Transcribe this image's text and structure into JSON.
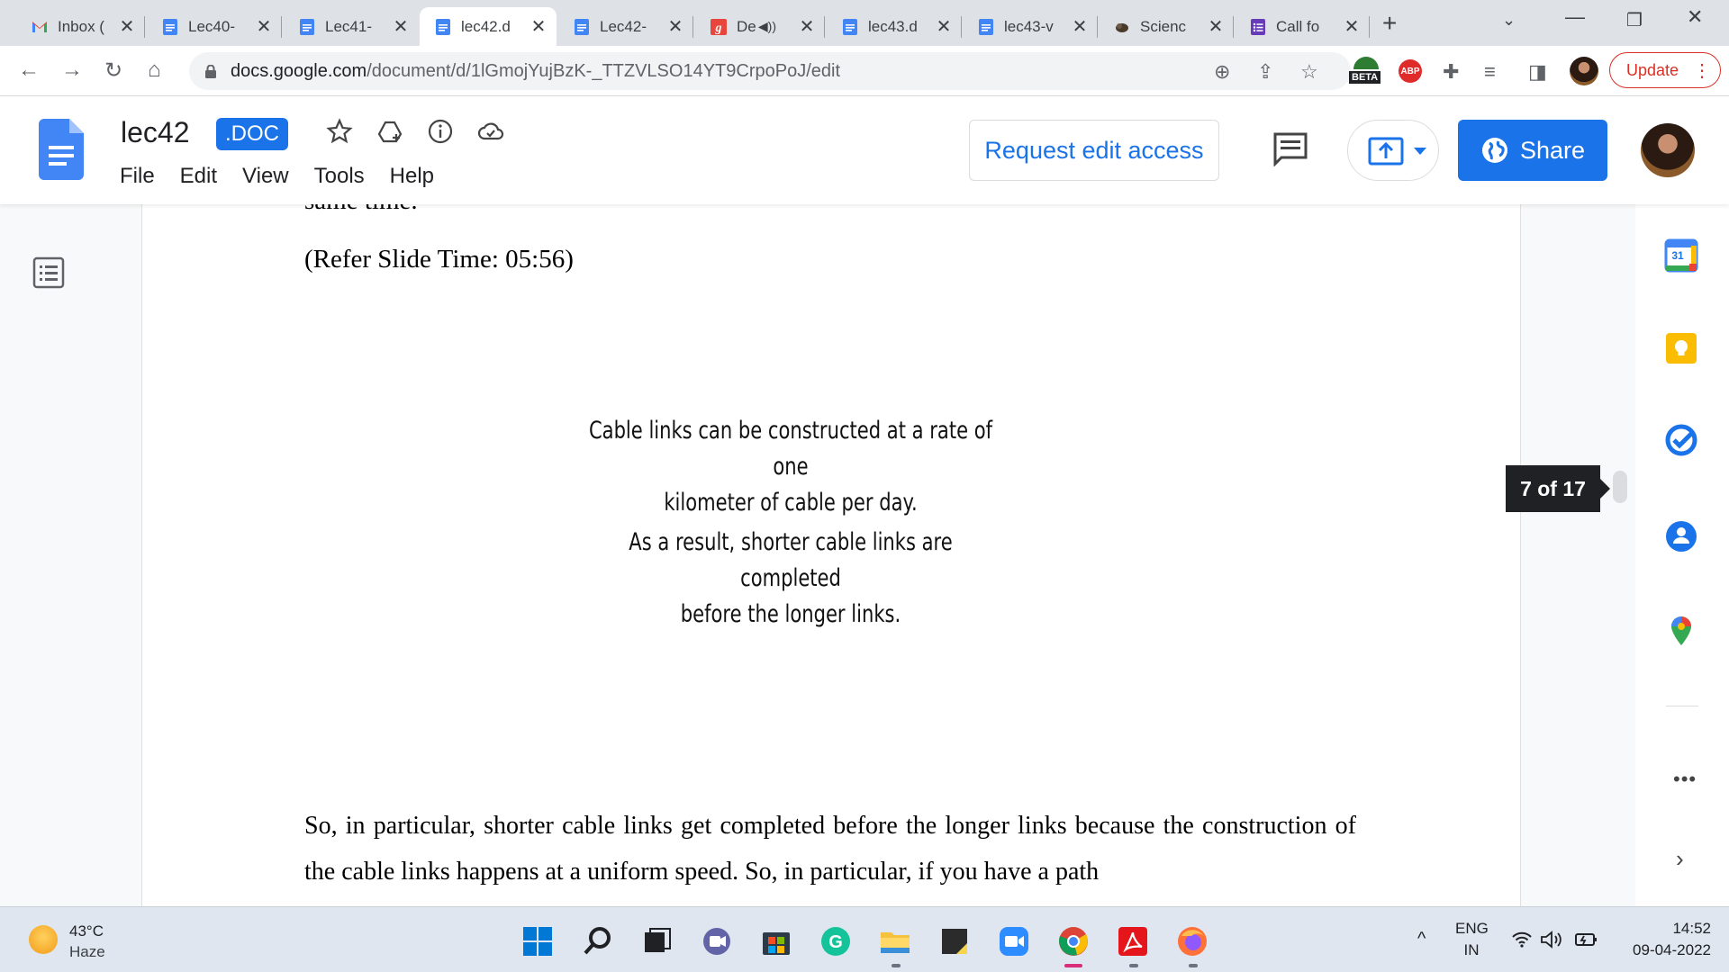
{
  "browser": {
    "tabs": [
      {
        "label": "Inbox (",
        "icon": "gmail-icon"
      },
      {
        "label": "Lec40-",
        "icon": "docs-icon"
      },
      {
        "label": "Lec41-",
        "icon": "docs-icon"
      },
      {
        "label": "lec42.d",
        "icon": "docs-icon",
        "active": true
      },
      {
        "label": "Lec42-",
        "icon": "docs-icon"
      },
      {
        "label": "De",
        "icon": "g-icon",
        "audio": true
      },
      {
        "label": "lec43.d",
        "icon": "docs-icon"
      },
      {
        "label": "lec43-v",
        "icon": "docs-icon"
      },
      {
        "label": "Scienc",
        "icon": "science-icon"
      },
      {
        "label": "Call fo",
        "icon": "forms-icon"
      }
    ],
    "address": {
      "url_host": "docs.google.com",
      "url_path": "/document/d/1lGmojYujBzK-_TTZVLSO14YT9CrpoPoJ/edit"
    },
    "update_label": "Update",
    "beta_label": "BETA",
    "abp_label": "ABP"
  },
  "docs": {
    "title": "lec42",
    "badge": ".DOC",
    "menu": [
      "File",
      "Edit",
      "View",
      "Tools",
      "Help"
    ],
    "request_edit_label": "Request edit access",
    "share_label": "Share"
  },
  "document": {
    "cut_line": "same time.",
    "slide_ref": "(Refer Slide Time: 05:56)",
    "slide_lines_1": [
      "Cable links can be constructed at a rate of one",
      "kilometer of cable per day."
    ],
    "slide_lines_2": [
      "As a result, shorter cable links are completed",
      "before the longer links."
    ],
    "body_text": "So, in particular, shorter cable links get completed before the longer links because the construction of the cable links happens at a uniform speed. So, in particular, if you have a path",
    "page_indicator": "7 of 17"
  },
  "sidepanel": {
    "calendar_day": "31"
  },
  "taskbar": {
    "weather_temp": "43°C",
    "weather_desc": "Haze",
    "lang_top": "ENG",
    "lang_bottom": "IN",
    "time": "14:52",
    "date": "09-04-2022"
  }
}
